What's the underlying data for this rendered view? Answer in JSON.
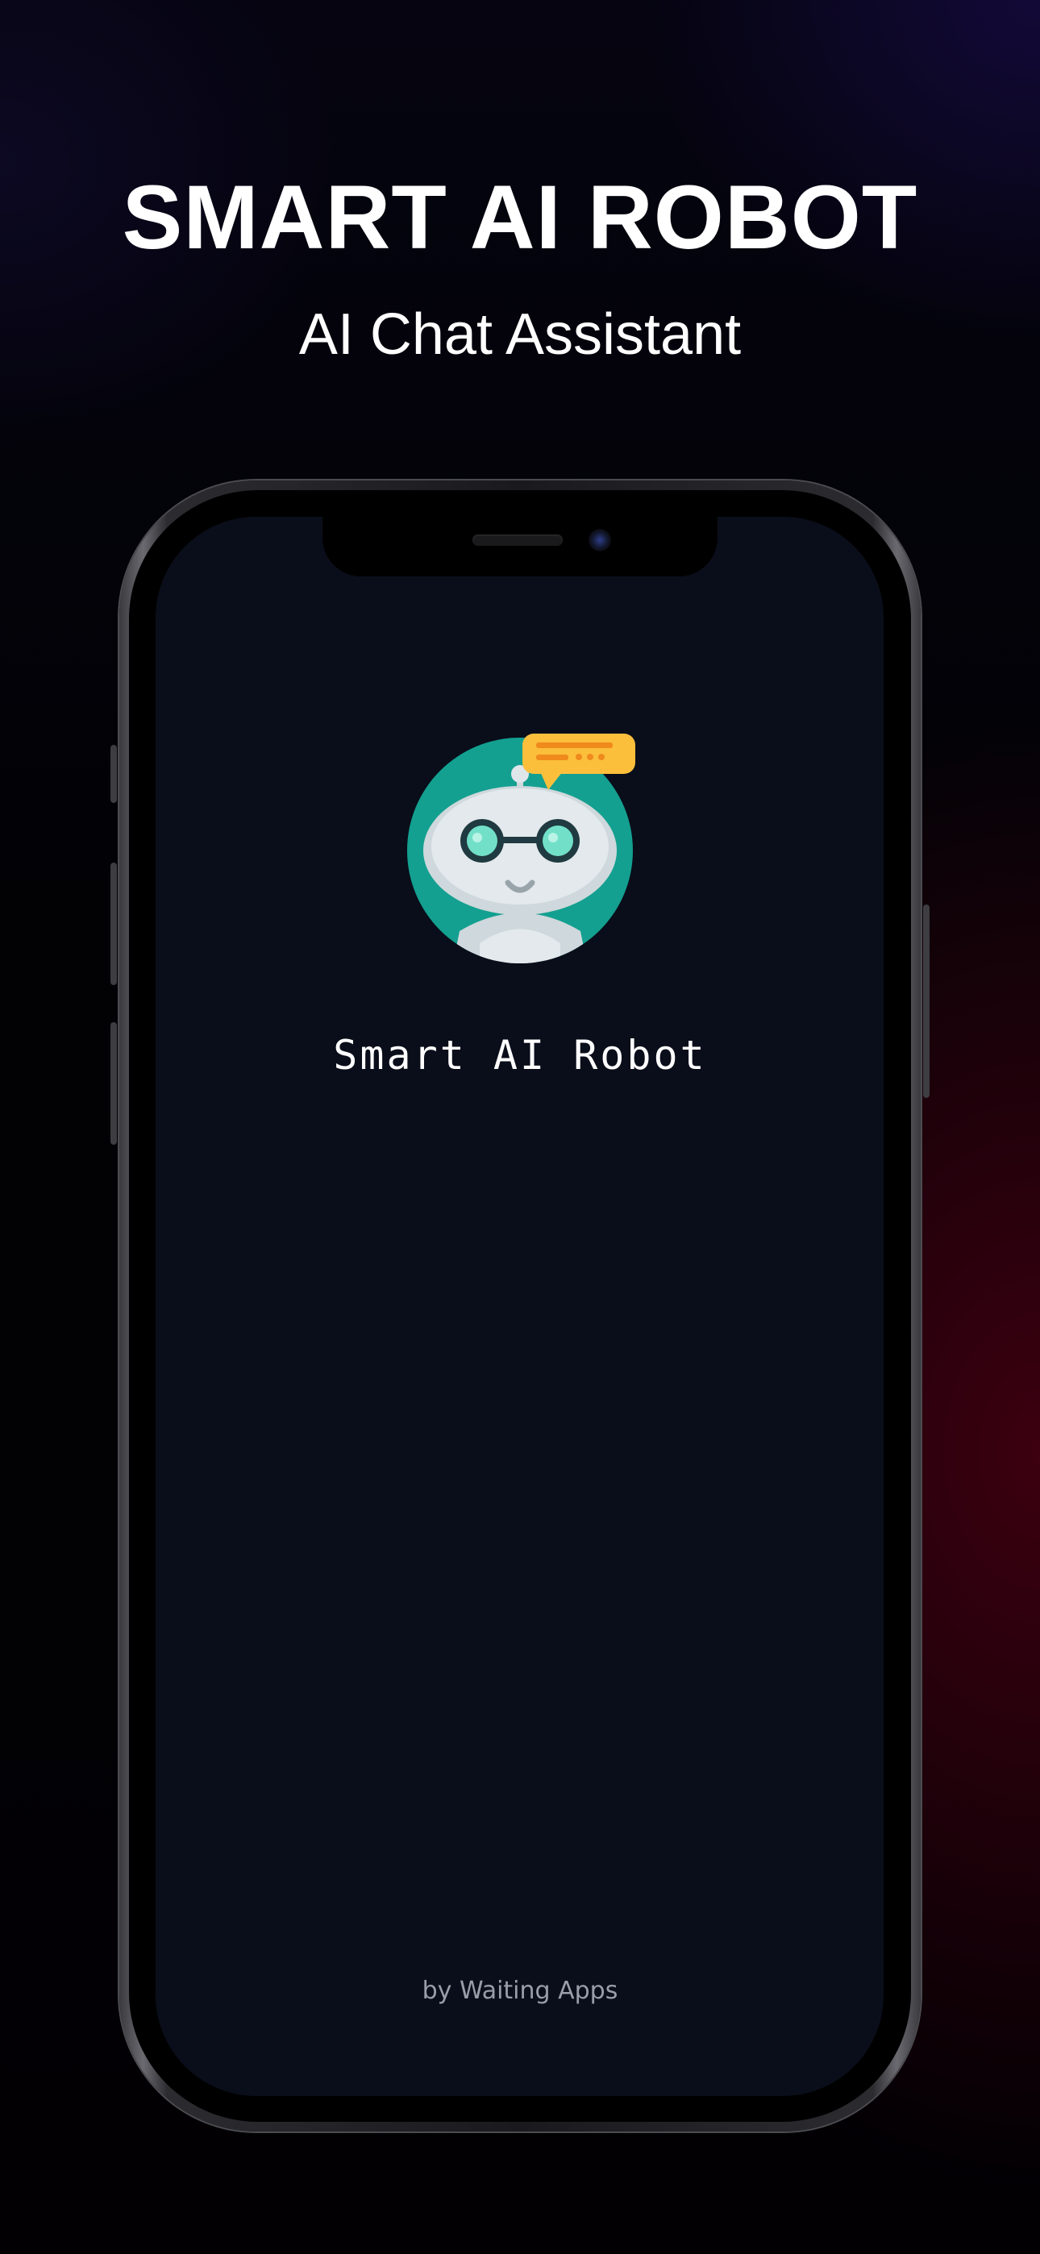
{
  "promo": {
    "headline": "SMART AI ROBOT",
    "subheadline": "AI Chat Assistant"
  },
  "device": {
    "model": "iphone-frame"
  },
  "app_screen": {
    "logo_icon": "robot-chat-icon",
    "app_name": "Smart AI Robot",
    "byline": "by Waiting Apps",
    "background": "#0a0e1a"
  },
  "colors": {
    "logo_circle": "#13a090",
    "speech_bubble": "#fbbf3c",
    "robot_face": "#dfe6ea",
    "glasses_lens": "#72e0c8"
  }
}
